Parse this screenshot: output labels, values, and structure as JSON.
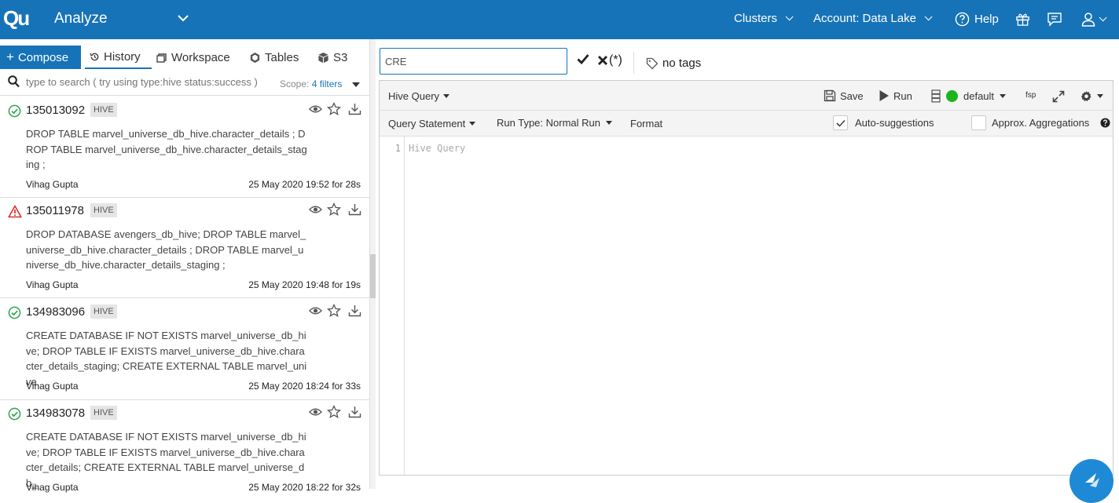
{
  "header": {
    "logo": "Qu",
    "app_title": "Analyze",
    "clusters": "Clusters",
    "account": "Account: Data Lake",
    "help": "Help"
  },
  "left_tabs": {
    "compose": "Compose",
    "history": "History",
    "workspace": "Workspace",
    "tables": "Tables",
    "s3": "S3"
  },
  "search": {
    "placeholder": "type to search ( try using type:hive status:success )",
    "scope_label": "Scope:",
    "scope_filters": "4 filters"
  },
  "history": [
    {
      "id": "135013092",
      "status": "success",
      "type": "HIVE",
      "text": "DROP TABLE marvel_universe_db_hive.character_details ; DROP TABLE marvel_universe_db_hive.character_details_staging ;",
      "author": "Vihag Gupta",
      "time": "25 May 2020 19:52 for 28s"
    },
    {
      "id": "135011978",
      "status": "error",
      "type": "HIVE",
      "text": "DROP DATABASE avengers_db_hive; DROP TABLE marvel_universe_db_hive.character_details ; DROP TABLE marvel_universe_db_hive.character_details_staging ;",
      "author": "Vihag Gupta",
      "time": "25 May 2020 19:48 for 19s"
    },
    {
      "id": "134983096",
      "status": "success",
      "type": "HIVE",
      "text": "CREATE DATABASE IF NOT EXISTS marvel_universe_db_hive; DROP TABLE IF EXISTS marvel_universe_db_hive.character_details_staging; CREATE EXTERNAL TABLE marvel_unive",
      "author": "Vihag Gupta",
      "time": "25 May 2020 18:24 for 33s"
    },
    {
      "id": "134983078",
      "status": "success",
      "type": "HIVE",
      "text": "CREATE DATABASE IF NOT EXISTS marvel_universe_db_hive; DROP TABLE IF EXISTS marvel_universe_db_hive.character_details; CREATE EXTERNAL TABLE marvel_universe_db_",
      "author": "Vihag Gupta",
      "time": "25 May 2020 18:22 for 32s"
    }
  ],
  "query_title": {
    "value": "CRE",
    "cancel_label": "(*)",
    "tags": "no tags"
  },
  "toolbar": {
    "query_type": "Hive Query",
    "save": "Save",
    "run": "Run",
    "cluster": "default",
    "fsp": "fsp",
    "query_statement": "Query Statement",
    "run_type": "Run Type: Normal Run",
    "format": "Format",
    "auto_suggestions": "Auto-suggestions",
    "approx_aggregations": "Approx. Aggregations"
  },
  "editor": {
    "line_number": "1",
    "placeholder": "Hive Query"
  },
  "colors": {
    "brand": "#1773b7",
    "success": "#2ea44f",
    "error": "#d9302c",
    "cluster_on": "#1db31d"
  }
}
